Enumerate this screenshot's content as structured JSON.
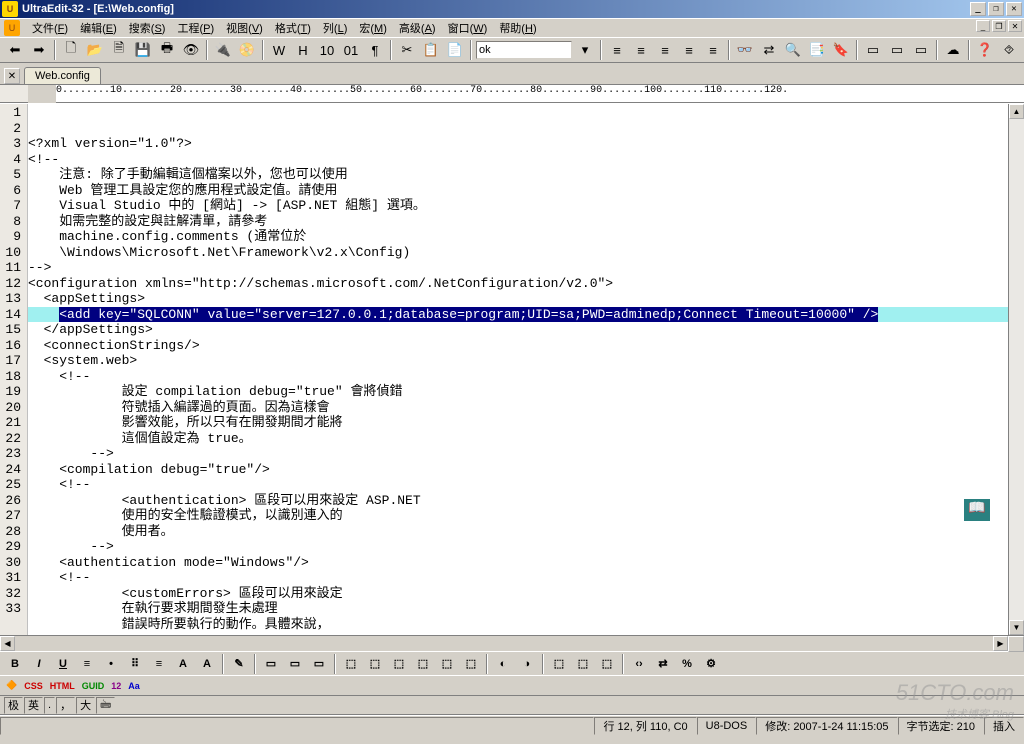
{
  "title": "UltraEdit-32 - [E:\\Web.config]",
  "menus": [
    "文件(F)",
    "编辑(E)",
    "搜索(S)",
    "工程(P)",
    "视图(V)",
    "格式(T)",
    "列(L)",
    "宏(M)",
    "高级(A)",
    "窗口(W)",
    "帮助(H)"
  ],
  "find_value": "ok",
  "tab_name": "Web.config",
  "ruler_marks": "0........10........20........30........40........50........60........70........80........90.......100.......110.......120.",
  "code_lines": [
    "<?xml version=\"1.0\"?>",
    "<!-- ",
    "    注意: 除了手動編輯這個檔案以外，您也可以使用 ",
    "    Web 管理工具設定您的應用程式設定值。請使用",
    "    Visual Studio 中的 [網站] -> [ASP.NET 組態] 選項。",
    "    如需完整的設定與註解清單，請參考 ",
    "    machine.config.comments (通常位於 ",
    "    \\Windows\\Microsoft.Net\\Framework\\v2.x\\Config) ",
    "-->",
    "<configuration xmlns=\"http://schemas.microsoft.com/.NetConfiguration/v2.0\">",
    "  <appSettings>",
    {
      "pre": "    ",
      "hl": "<add key=\"SQLCONN\" value=\"server=127.0.0.1;database=program;UID=sa;PWD=adminedp;Connect Timeout=10000\" />",
      "cyan": true
    },
    "  </appSettings>",
    "  <connectionStrings/>",
    "  <system.web>",
    "    <!-- ",
    "            設定 compilation debug=\"true\" 會將偵錯 ",
    "            符號插入編譯過的頁面。因為這樣會 ",
    "            影響效能，所以只有在開發期間才能將 ",
    "            這個值設定為 true。",
    "        -->",
    "    <compilation debug=\"true\"/>",
    "    <!--",
    "            <authentication> 區段可以用來設定 ASP.NET ",
    "            使用的安全性驗證模式，以識別連入的 ",
    "            使用者。 ",
    "        -->",
    "    <authentication mode=\"Windows\"/>",
    "    <!--",
    "            <customErrors> 區段可以用來設定",
    "            在執行要求期間發生未處理 ",
    "            錯誤時所要執行的動作。具體來說，",
    ""
  ],
  "status": {
    "pos": "行 12, 列 110, C0",
    "enc": "U8-DOS",
    "modified": "修改: 2007-1-24 11:15:05",
    "bytes": "字节选定: 210",
    "mode": "插入"
  },
  "toolbar_icons": [
    "⬅",
    "➡",
    "|",
    "🗋",
    "📂",
    "🗎",
    "💾",
    "🖶",
    "👁",
    "|",
    "🔌",
    "📀",
    "|",
    "W",
    "H",
    "10",
    "01",
    "¶",
    "|",
    "✂",
    "📋",
    "📄",
    "|",
    "find",
    "▾",
    "|",
    "≡",
    "≡",
    "≡",
    "≡",
    "≡",
    "|",
    "👓",
    "⇄",
    "🔍",
    "📑",
    "🔖",
    "|",
    "▭",
    "▭",
    "▭",
    "|",
    "☁",
    "|",
    "❓",
    "⯑"
  ],
  "bottom_toolbar": [
    "B",
    "I",
    "U",
    "≡",
    "•",
    "⠿",
    "≡",
    "A",
    "A",
    "|",
    "✎",
    "|",
    "▭",
    "▭",
    "▭",
    "|",
    "⬚",
    "⬚",
    "⬚",
    "⬚",
    "⬚",
    "⬚",
    "|",
    "◐",
    "◑",
    "|",
    "⬚",
    "⬚",
    "⬚",
    "|",
    "‹›",
    "⇄",
    "%",
    "⚙"
  ],
  "extra_toolbar": [
    "🔶",
    "CSS",
    "HTML",
    "GUID",
    "12",
    "Aa"
  ],
  "ime": [
    "极",
    "英",
    ".",
    "，",
    "大",
    "🖮"
  ],
  "watermark": {
    "main": "51CTO.com",
    "sub": "技术博客 Blog"
  }
}
